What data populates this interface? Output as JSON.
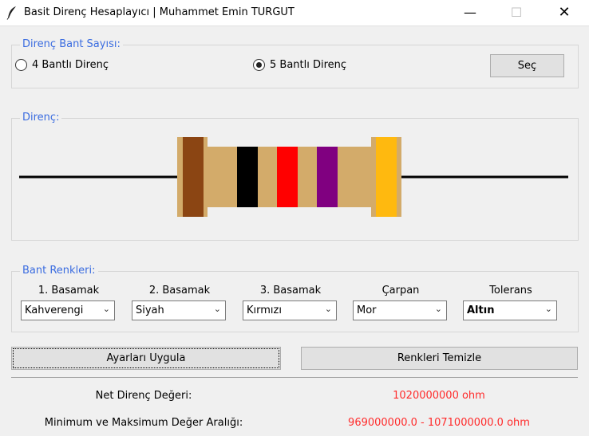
{
  "window": {
    "title": "Basit Direnç Hesaplayıcı | Muhammet Emin TURGUT"
  },
  "band_count": {
    "legend": "Direnç Bant Sayısı:",
    "option_4": "4 Bantlı Direnç",
    "option_5": "5 Bantlı Direnç",
    "selected": "5",
    "select_button": "Seç"
  },
  "resistor": {
    "legend": "Direnç:",
    "bands": [
      "#8b4513",
      "#000000",
      "#ff0000",
      "#800080",
      "#ffb90f"
    ],
    "body_color": "#d3ab6a",
    "wire_color": "#000000"
  },
  "band_colors": {
    "legend": "Bant Renkleri:",
    "columns": [
      {
        "header": "1. Basamak",
        "value": "Kahverengi"
      },
      {
        "header": "2. Basamak",
        "value": "Siyah"
      },
      {
        "header": "3. Basamak",
        "value": "Kırmızı"
      },
      {
        "header": "Çarpan",
        "value": "Mor"
      },
      {
        "header": "Tolerans",
        "value": "Altın"
      }
    ]
  },
  "actions": {
    "apply": "Ayarları Uygula",
    "clear": "Renkleri Temizle"
  },
  "result": {
    "net_label": "Net Direnç Değeri:",
    "net_value": "1020000000 ohm",
    "range_label": "Minimum ve Maksimum Değer Aralığı:",
    "range_value": "969000000.0 - 1071000000.0 ohm",
    "value_color": "#ff2b2b"
  }
}
